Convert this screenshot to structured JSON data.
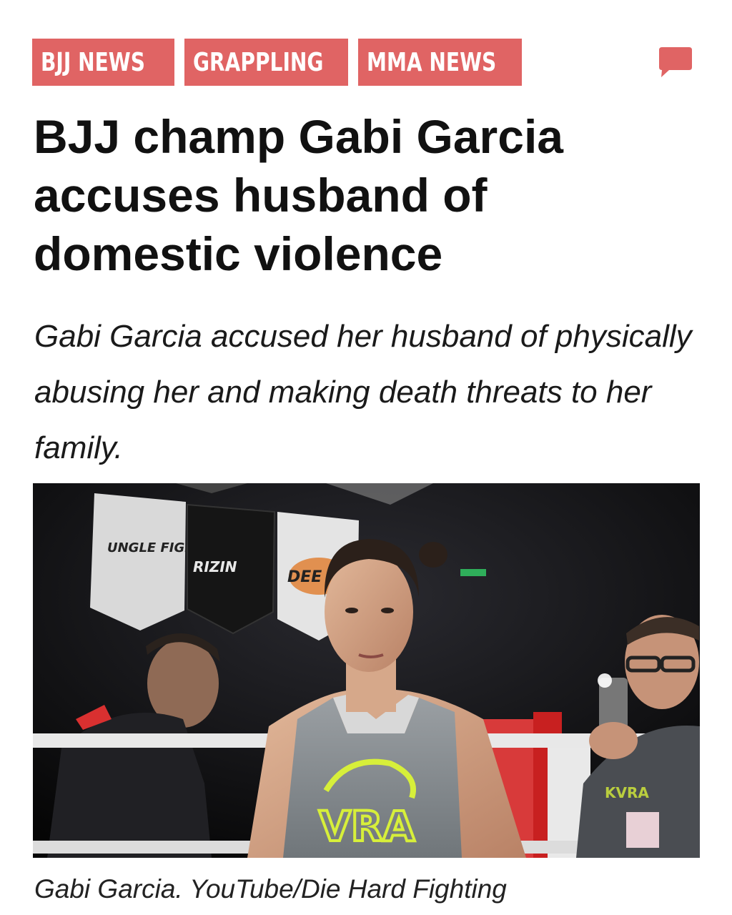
{
  "tags": [
    {
      "label": "BJJ NEWS"
    },
    {
      "label": "GRAPPLING"
    },
    {
      "label": "MMA NEWS"
    }
  ],
  "comment_icon": "speech-bubble-icon",
  "article": {
    "headline": "BJJ champ Gabi Garcia accuses husband of domestic violence",
    "dek": "Gabi Garcia accused her husband of physically abusing her and making death threats to her family.",
    "photo": {
      "banner_texts": [
        "UNGLE FIGHT",
        "RIZIN",
        "DEE"
      ],
      "shirt_text": "VRA",
      "bystander_shirt_text": "KVRA"
    },
    "caption": "Gabi Garcia. YouTube/Die Hard Fighting"
  },
  "colors": {
    "tag_background": "#e06464",
    "tag_text": "#ffffff",
    "headline": "#111111",
    "shirt_accent": "#d7ef3a"
  }
}
